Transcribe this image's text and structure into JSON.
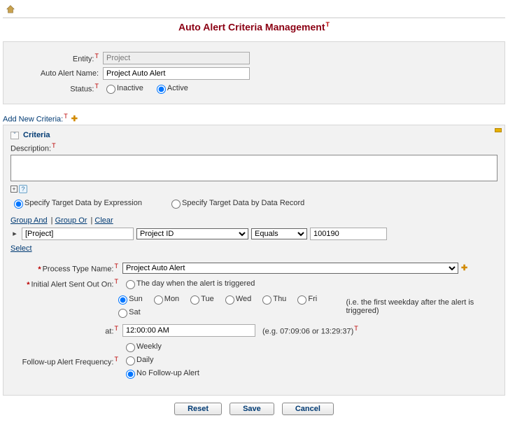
{
  "page_title": "Auto Alert Criteria Management",
  "top_panel": {
    "entity_label": "Entity:",
    "entity_value": "Project",
    "name_label": "Auto Alert Name:",
    "name_value": "Project Auto Alert",
    "status_label": "Status:",
    "status_inactive": "Inactive",
    "status_active": "Active"
  },
  "add_criteria_label": "Add New Criteria:",
  "criteria": {
    "section_title": "Criteria",
    "description_label": "Description:",
    "description_value": "",
    "target_by_expression": "Specify Target Data by Expression",
    "target_by_record": "Specify Target Data by Data Record",
    "group_and": "Group And",
    "group_or": "Group Or",
    "clear": "Clear",
    "rule": {
      "entity": "[Project]",
      "field": "Project ID",
      "op": "Equals",
      "value": "100190"
    },
    "select_link": "Select"
  },
  "process": {
    "process_type_label": "Process Type Name:",
    "process_type_value": "Project Auto Alert",
    "initial_label": "Initial Alert Sent Out On:",
    "trigger_day_option": "The day when the alert is triggered",
    "days": {
      "sun": "Sun",
      "mon": "Mon",
      "tue": "Tue",
      "wed": "Wed",
      "thu": "Thu",
      "fri": "Fri",
      "sat": "Sat"
    },
    "days_note": "(i.e. the first weekday after the alert is triggered)",
    "at_label": "at:",
    "at_value": "12:00:00 AM",
    "at_hint": "(e.g. 07:09:06 or 13:29:37)",
    "followup_label": "Follow-up Alert Frequency:",
    "followup": {
      "weekly": "Weekly",
      "daily": "Daily",
      "none": "No Follow-up Alert"
    }
  },
  "buttons": {
    "reset": "Reset",
    "save": "Save",
    "cancel": "Cancel"
  }
}
